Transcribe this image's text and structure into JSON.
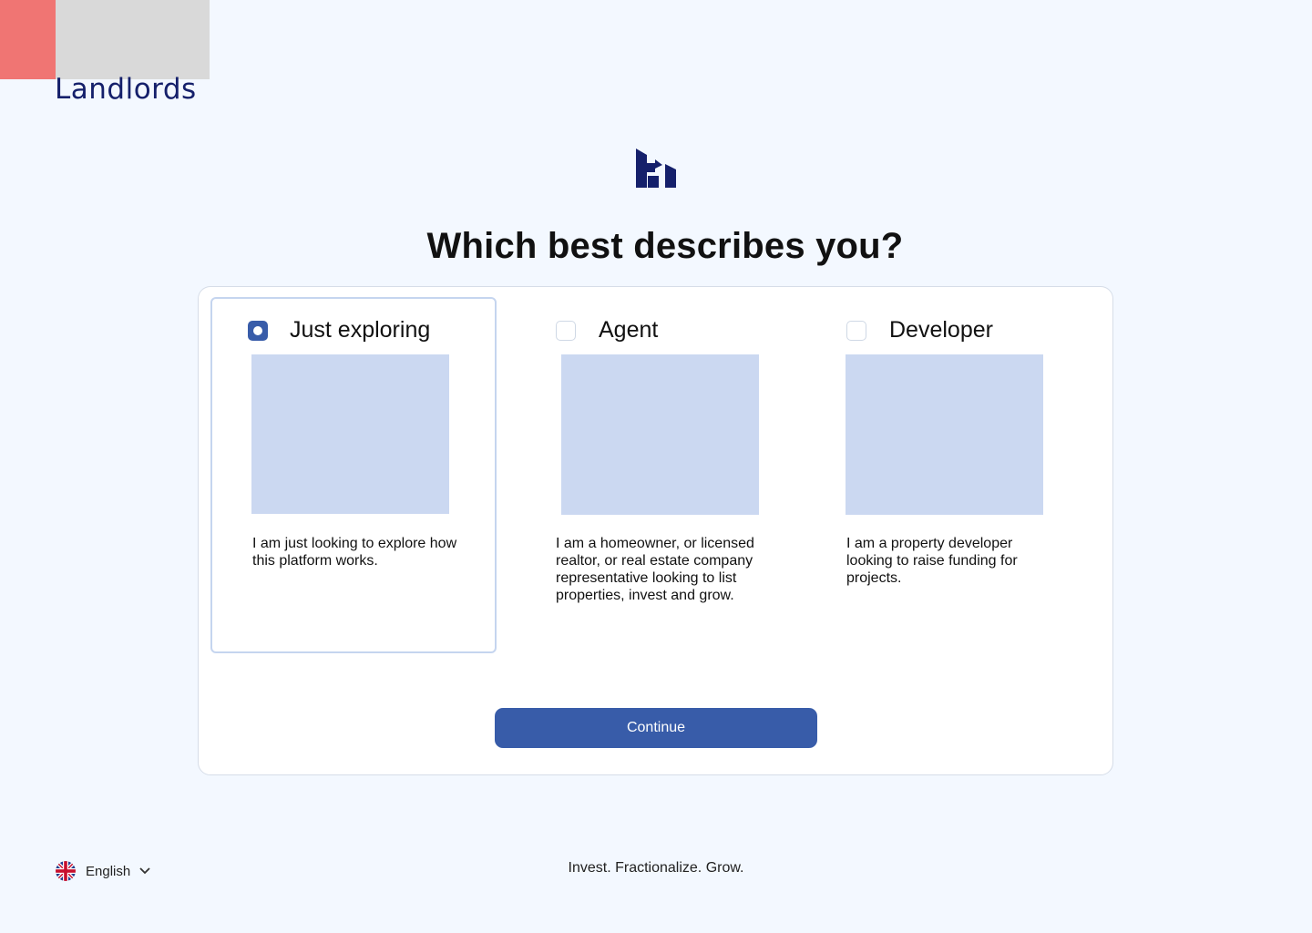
{
  "brand": {
    "name": "Landlords",
    "accent_color": "#f07573",
    "primary_color": "#15206b"
  },
  "page": {
    "heading": "Which best describes you?"
  },
  "options": [
    {
      "title": "Just exploring",
      "description": "I am just looking to explore how this platform works.",
      "selected": true
    },
    {
      "title": "Agent",
      "description": "I am a homeowner, or licensed realtor, or real estate company representative looking to list properties, invest and grow.",
      "selected": false
    },
    {
      "title": "Developer",
      "description": "I am a property developer looking to raise funding for projects.",
      "selected": false
    }
  ],
  "actions": {
    "continue_label": "Continue",
    "button_color": "#385ca9"
  },
  "footer": {
    "language": {
      "label": "English",
      "flag_icon": "uk-flag-icon",
      "dropdown_icon": "chevron-down-icon"
    },
    "tagline": "Invest. Fractionalize. Grow."
  }
}
